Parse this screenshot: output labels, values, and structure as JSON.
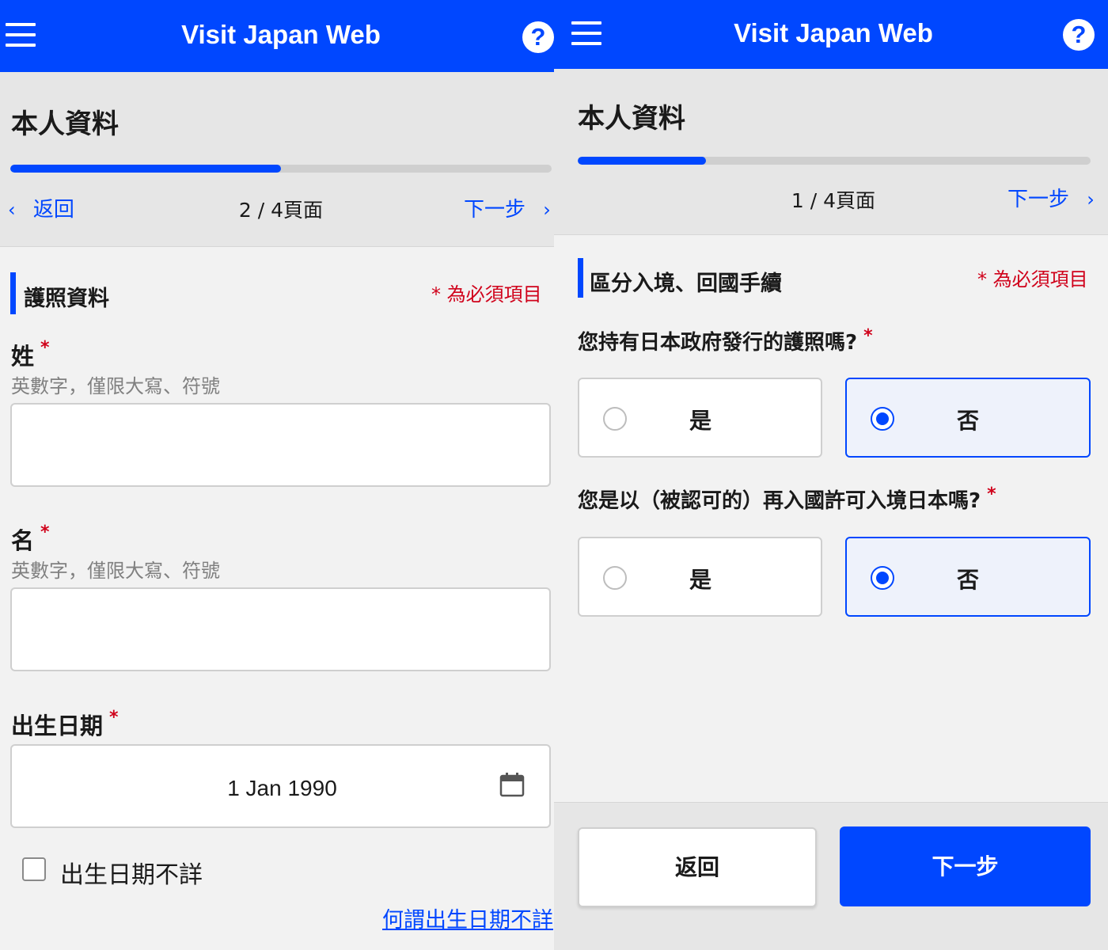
{
  "app": {
    "title": "Visit Japan Web",
    "help_symbol": "?"
  },
  "left": {
    "page_title": "本人資料",
    "progress": 0.5,
    "nav": {
      "back": "返回",
      "page": "2 / 4頁面",
      "next": "下一步"
    },
    "section": {
      "title": "護照資料",
      "required_note": "* 為必須項目"
    },
    "fields": [
      {
        "label": "姓",
        "hint": "英數字，僅限大寫、符號",
        "value": ""
      },
      {
        "label": "名",
        "hint": "英數字，僅限大寫、符號",
        "value": ""
      }
    ],
    "birth": {
      "label": "出生日期",
      "value": "1 Jan 1990"
    },
    "unknown_birth": {
      "label": "出生日期不詳",
      "checked": false
    },
    "help_link": "何謂出生日期不詳",
    "required_mark": "*"
  },
  "right": {
    "page_title": "本人資料",
    "progress": 0.25,
    "nav": {
      "page": "1 / 4頁面",
      "next": "下一步"
    },
    "section": {
      "title": "區分入境、回國手續",
      "required_note": "* 為必須項目"
    },
    "questions": [
      {
        "text": "您持有日本政府發行的護照嗎?",
        "options": [
          "是",
          "否"
        ],
        "selected": "否"
      },
      {
        "text": "您是以（被認可的）再入國許可入境日本嗎?",
        "options": [
          "是",
          "否"
        ],
        "selected": "否"
      }
    ],
    "footer": {
      "back": "返回",
      "next": "下一步"
    },
    "required_mark": "*"
  },
  "icons": [
    "menu-icon",
    "help-icon",
    "chevron-left-icon",
    "chevron-right-icon",
    "calendar-icon",
    "radio-icon",
    "checkbox-icon"
  ],
  "colors": {
    "brand": "#0047ff",
    "required": "#d0021b",
    "header_bg": "#e6e6e6",
    "page_bg": "#f2f2f2"
  }
}
